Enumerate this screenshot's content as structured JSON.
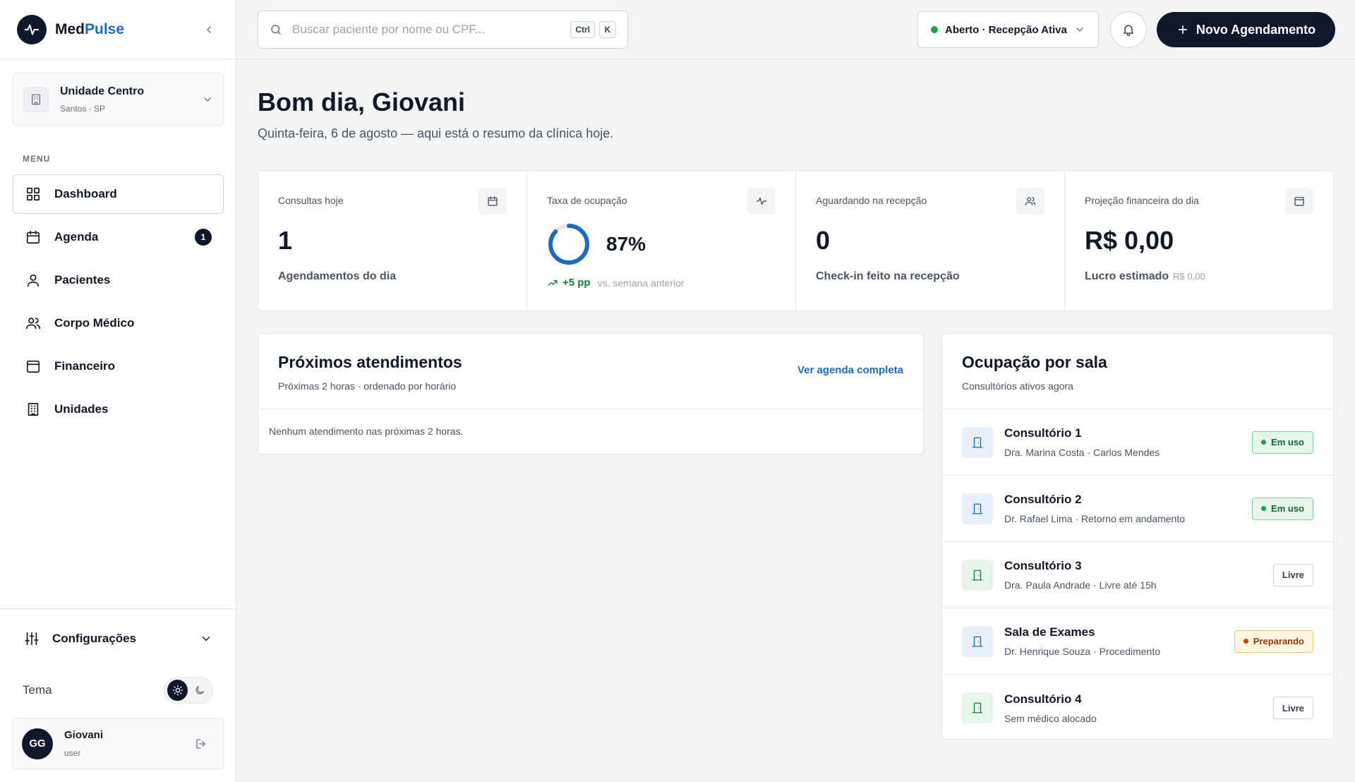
{
  "brand": {
    "name_part1": "Med",
    "name_part2": "Pulse",
    "accent_color": "#1d6bbf",
    "dark_color": "#0f172a"
  },
  "unit": {
    "name": "Unidade Centro",
    "location": "Santos · SP"
  },
  "menu": {
    "section_label": "MENU",
    "items": [
      {
        "label": "Dashboard",
        "icon": "grid-icon",
        "active": true
      },
      {
        "label": "Agenda",
        "icon": "calendar-icon",
        "badge": "1"
      },
      {
        "label": "Pacientes",
        "icon": "user-icon"
      },
      {
        "label": "Corpo Médico",
        "icon": "users-icon"
      },
      {
        "label": "Financeiro",
        "icon": "wallet-icon"
      },
      {
        "label": "Unidades",
        "icon": "building-icon"
      }
    ]
  },
  "settings": {
    "label": "Configurações"
  },
  "theme": {
    "label": "Tema",
    "mode": "light"
  },
  "user": {
    "initials": "GG",
    "name": "Giovani",
    "role": "user"
  },
  "topbar": {
    "search_placeholder": "Buscar paciente por nome ou CPF...",
    "shortcut": [
      "Ctrl",
      "K"
    ],
    "status": "Aberto · Recepção Ativa",
    "new_button": "Novo Agendamento"
  },
  "greeting": {
    "title": "Bom dia, Giovani",
    "subtitle": "Quinta-feira, 6 de agosto — aqui está o resumo da clínica hoje."
  },
  "kpis": [
    {
      "title": "Consultas hoje",
      "value": "1",
      "sub": "Agendamentos do dia",
      "icon": "calendar-icon"
    },
    {
      "title": "Taxa de ocupação",
      "value": "87%",
      "percent": 87,
      "trend": "+5 pp",
      "trend_note": "vs. semana anterior",
      "icon": "activity-icon"
    },
    {
      "title": "Aguardando na recepção",
      "value": "0",
      "sub": "Check-in feito na recepção",
      "icon": "users-icon"
    },
    {
      "title": "Projeção financeira do dia",
      "value": "R$ 0,00",
      "sub": "Lucro estimado",
      "sub_small": "R$ 0,00",
      "icon": "wallet-icon"
    }
  ],
  "upcoming": {
    "title": "Próximos atendimentos",
    "subtitle": "Próximas 2 horas · ordenado por horário",
    "link": "Ver agenda completa",
    "empty": "Nenhum atendimento nas próximas 2 horas."
  },
  "rooms": {
    "title": "Ocupação por sala",
    "subtitle": "Consultórios ativos agora",
    "items": [
      {
        "name": "Consultório 1",
        "detail": "Dra. Marina Costa · Carlos Mendes",
        "status": "Em uso",
        "kind": "inuse"
      },
      {
        "name": "Consultório 2",
        "detail": "Dr. Rafael Lima · Retorno em andamento",
        "status": "Em uso",
        "kind": "inuse"
      },
      {
        "name": "Consultório 3",
        "detail": "Dra. Paula Andrade · Livre até 15h",
        "status": "Livre",
        "kind": "free"
      },
      {
        "name": "Sala de Exames",
        "detail": "Dr. Henrique Souza · Procedimento",
        "status": "Preparando",
        "kind": "prep"
      },
      {
        "name": "Consultório 4",
        "detail": "Sem médico alocado",
        "status": "Livre",
        "kind": "free"
      }
    ]
  },
  "colors": {
    "inuse_bg": "#e6f6ea",
    "inuse_border": "#86d29b",
    "inuse_text": "#166534",
    "inuse_dot": "#16a34a",
    "free_bg": "#ffffff",
    "free_border": "#d1d5db",
    "free_text": "#374151",
    "prep_bg": "#fff7e0",
    "prep_border": "#f5c96a",
    "prep_text": "#9a3412",
    "prep_dot": "#c2410c",
    "room_ic_blue": "#e8f1fb",
    "room_ic_green": "#e7f6ea"
  }
}
